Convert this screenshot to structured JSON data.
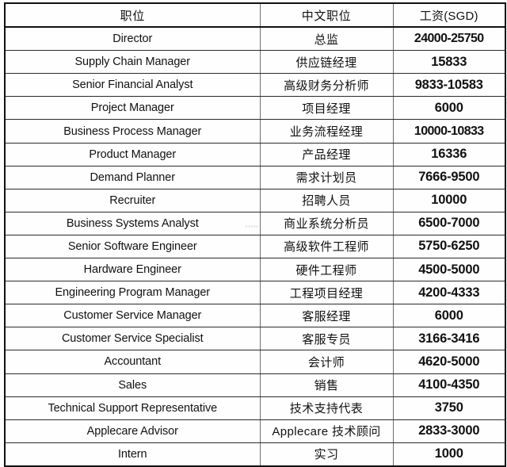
{
  "table": {
    "columns": [
      {
        "key": "role",
        "label": "职位"
      },
      {
        "key": "role_cn",
        "label": "中文职位"
      },
      {
        "key": "salary",
        "label": "工资(SGD)"
      }
    ],
    "rows": [
      {
        "role": "Director",
        "role_cn": "总监",
        "salary": "24000-25750"
      },
      {
        "role": "Supply Chain Manager",
        "role_cn": "供应链经理",
        "salary": "15833"
      },
      {
        "role": "Senior Financial Analyst",
        "role_cn": "高级财务分析师",
        "salary": "9833-10583"
      },
      {
        "role": "Project Manager",
        "role_cn": "项目经理",
        "salary": "6000"
      },
      {
        "role": "Business Process Manager",
        "role_cn": "业务流程经理",
        "salary": "10000-10833"
      },
      {
        "role": "Product Manager",
        "role_cn": "产品经理",
        "salary": "16336"
      },
      {
        "role": "Demand Planner",
        "role_cn": "需求计划员",
        "salary": "7666-9500"
      },
      {
        "role": "Recruiter",
        "role_cn": "招聘人员",
        "salary": "10000"
      },
      {
        "role": "Business Systems Analyst",
        "role_cn": "商业系统分析员",
        "salary": "6500-7000"
      },
      {
        "role": "Senior Software Engineer",
        "role_cn": "高级软件工程师",
        "salary": "5750-6250"
      },
      {
        "role": "Hardware Engineer",
        "role_cn": "硬件工程师",
        "salary": "4500-5000"
      },
      {
        "role": "Engineering Program Manager",
        "role_cn": "工程项目经理",
        "salary": "4200-4333"
      },
      {
        "role": "Customer Service Manager",
        "role_cn": "客服经理",
        "salary": "6000"
      },
      {
        "role": "Customer Service Specialist",
        "role_cn": "客服专员",
        "salary": "3166-3416"
      },
      {
        "role": "Accountant",
        "role_cn": "会计师",
        "salary": "4620-5000"
      },
      {
        "role": "Sales",
        "role_cn": "销售",
        "salary": "4100-4350"
      },
      {
        "role": "Technical Support Representative",
        "role_cn": "技术支持代表",
        "salary": "3750"
      },
      {
        "role": "Applecare Advisor",
        "role_cn": "Applecare 技术顾问",
        "salary": "2833-3000"
      },
      {
        "role": "Intern",
        "role_cn": "实习",
        "salary": "1000"
      }
    ]
  },
  "watermark": {
    "text": "▪▪▪▪▪"
  },
  "colors": {
    "text": "#111111",
    "cell_background": "#fefefe",
    "page_background": "#ffffff",
    "outer_border": "#111111",
    "row_rule": "#2b2b2b",
    "column_rule": "#6f6f6f"
  }
}
